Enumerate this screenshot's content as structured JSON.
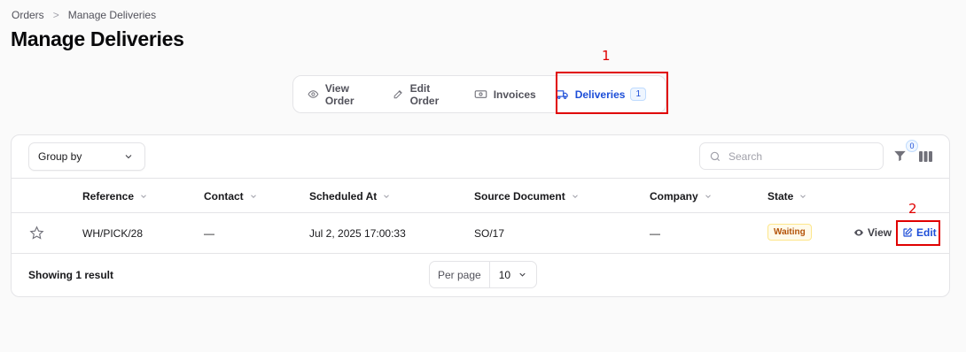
{
  "breadcrumb": {
    "items": [
      "Orders",
      "Manage Deliveries"
    ],
    "separator": ">"
  },
  "page_title": "Manage Deliveries",
  "tabs": [
    {
      "label": "View Order",
      "icon": "eye-icon",
      "active": false
    },
    {
      "label": "Edit Order",
      "icon": "edit-icon",
      "active": false
    },
    {
      "label": "Invoices",
      "icon": "banknote-icon",
      "active": false
    },
    {
      "label": "Deliveries",
      "icon": "truck-icon",
      "active": true,
      "badge": "1"
    }
  ],
  "annotations": [
    {
      "label": "1",
      "target": "tab-deliveries"
    },
    {
      "label": "2",
      "target": "edit-button"
    }
  ],
  "toolbar": {
    "group_by_label": "Group by",
    "search_placeholder": "Search",
    "filter_count": "0"
  },
  "table": {
    "columns": [
      "Reference",
      "Contact",
      "Scheduled At",
      "Source Document",
      "Company",
      "State"
    ],
    "rows": [
      {
        "reference": "WH/PICK/28",
        "contact": "—",
        "scheduled_at": "Jul 2, 2025 17:00:33",
        "source_document": "SO/17",
        "company": "—",
        "state": "Waiting",
        "actions": {
          "view": "View",
          "edit": "Edit"
        }
      }
    ]
  },
  "footer": {
    "showing": "Showing 1 result",
    "per_page_label": "Per page",
    "per_page_value": "10"
  },
  "colors": {
    "accent": "#1d4ed8",
    "annotation": "#e00000",
    "state_waiting": "#b45309",
    "border": "#e4e4e7"
  }
}
